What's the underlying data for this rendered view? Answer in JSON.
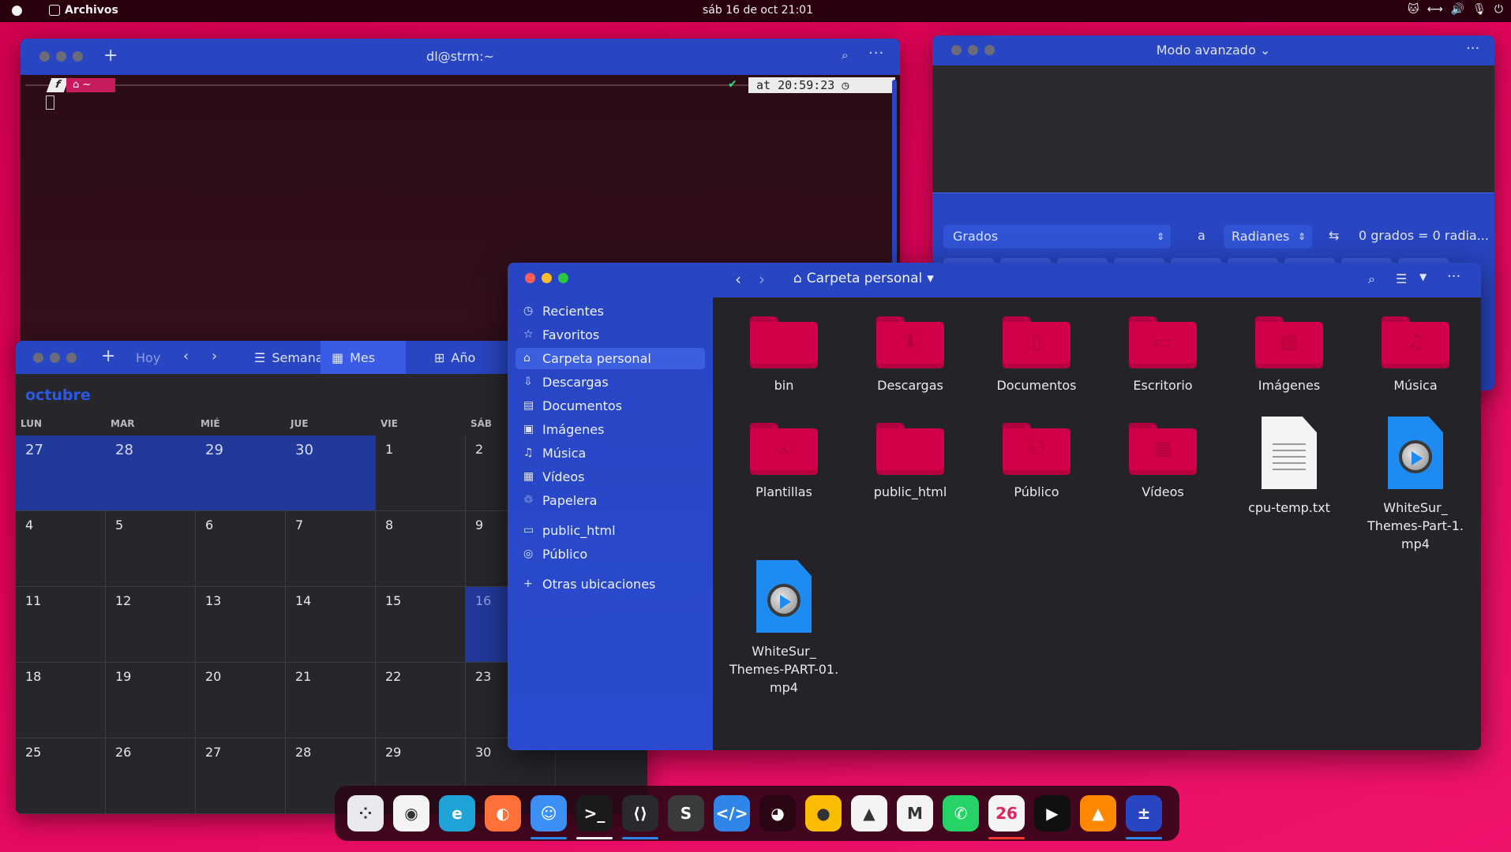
{
  "topbar": {
    "app_name": "Archivos",
    "clock": "sáb 16 de oct  21:01"
  },
  "terminal": {
    "title": "dl@strm:~",
    "prompt_home": "~",
    "time": "at 20:59:23"
  },
  "calculator": {
    "title": "Modo avanzado",
    "from_unit": "Grados",
    "to_word": "a",
    "to_unit": "Radianes",
    "result": "0 grados  =  0 radia..."
  },
  "calendar": {
    "today_label": "Hoy",
    "views": [
      "Semana",
      "Mes",
      "Año"
    ],
    "active_view": "Mes",
    "month": "octubre",
    "weekdays": [
      "LUN",
      "MAR",
      "MIÉ",
      "JUE",
      "VIE",
      "SÁB"
    ],
    "weeks": [
      [
        "27",
        "28",
        "29",
        "30",
        "1",
        "2"
      ],
      [
        "4",
        "5",
        "6",
        "7",
        "8",
        "9"
      ],
      [
        "11",
        "12",
        "13",
        "14",
        "15",
        "16"
      ],
      [
        "18",
        "19",
        "20",
        "21",
        "22",
        "23"
      ],
      [
        "25",
        "26",
        "27",
        "28",
        "29",
        "30"
      ]
    ]
  },
  "files": {
    "location": "Carpeta personal",
    "sidebar": [
      {
        "label": "Recientes",
        "icon": "clock-icon"
      },
      {
        "label": "Favoritos",
        "icon": "star-icon"
      },
      {
        "label": "Carpeta personal",
        "icon": "home-icon",
        "selected": true
      },
      {
        "label": "Descargas",
        "icon": "download-icon"
      },
      {
        "label": "Documentos",
        "icon": "document-icon"
      },
      {
        "label": "Imágenes",
        "icon": "image-icon"
      },
      {
        "label": "Música",
        "icon": "music-icon"
      },
      {
        "label": "Vídeos",
        "icon": "video-icon"
      },
      {
        "label": "Papelera",
        "icon": "trash-icon"
      }
    ],
    "bookmarks": [
      {
        "label": "public_html",
        "icon": "folder-icon"
      },
      {
        "label": "Público",
        "icon": "share-icon"
      }
    ],
    "other_locations": "Otras ubicaciones",
    "items": [
      {
        "name": "bin",
        "kind": "folder"
      },
      {
        "name": "Descargas",
        "kind": "folder"
      },
      {
        "name": "Documentos",
        "kind": "folder"
      },
      {
        "name": "Escritorio",
        "kind": "folder"
      },
      {
        "name": "Imágenes",
        "kind": "folder"
      },
      {
        "name": "Música",
        "kind": "folder"
      },
      {
        "name": "Plantillas",
        "kind": "folder"
      },
      {
        "name": "public_html",
        "kind": "folder"
      },
      {
        "name": "Público",
        "kind": "folder"
      },
      {
        "name": "Vídeos",
        "kind": "folder"
      },
      {
        "name": "cpu-temp.txt",
        "kind": "text"
      },
      {
        "name": "WhiteSur_ Themes-Part-1. mp4",
        "kind": "video"
      },
      {
        "name": "WhiteSur_ Themes-PART-01. mp4",
        "kind": "video"
      }
    ]
  },
  "dock": {
    "apps": [
      {
        "name": "launchpad",
        "icon": "grid-icon",
        "color": "#e9e9ef"
      },
      {
        "name": "chrome",
        "icon": "chrome-icon",
        "color": "#f4f4f4"
      },
      {
        "name": "edge-beta",
        "icon": "edge-icon",
        "color": "#1fa3d7"
      },
      {
        "name": "firefox",
        "icon": "firefox-icon",
        "color": "#ff7139"
      },
      {
        "name": "files",
        "icon": "finder-icon",
        "color": "#3b8ff5",
        "running": true
      },
      {
        "name": "terminal",
        "icon": "terminal-icon",
        "color": "#1b1b1b",
        "running": true
      },
      {
        "name": "vscode",
        "icon": "vscode-icon",
        "color": "#2a2a2e",
        "running": true
      },
      {
        "name": "sublime",
        "icon": "sublime-icon",
        "color": "#3a3a3a"
      },
      {
        "name": "dev-editor",
        "icon": "code-icon",
        "color": "#2f86e8"
      },
      {
        "name": "github",
        "icon": "github-icon",
        "color": "#2a0614"
      },
      {
        "name": "keep",
        "icon": "lightbulb-icon",
        "color": "#fbbc04"
      },
      {
        "name": "drive",
        "icon": "drive-icon",
        "color": "#f4f4f4"
      },
      {
        "name": "gmail",
        "icon": "gmail-icon",
        "color": "#f4f4f4"
      },
      {
        "name": "whatsapp",
        "icon": "whatsapp-icon",
        "color": "#25d366"
      },
      {
        "name": "calendar",
        "icon": "calendar-icon",
        "color": "#f4f4f4",
        "label": "26",
        "running": true
      },
      {
        "name": "media-player",
        "icon": "play-icon",
        "color": "#101010"
      },
      {
        "name": "vlc",
        "icon": "vlc-icon",
        "color": "#ff8800"
      },
      {
        "name": "calculator",
        "icon": "calculator-icon",
        "color": "#2845c2",
        "running": true
      }
    ]
  }
}
